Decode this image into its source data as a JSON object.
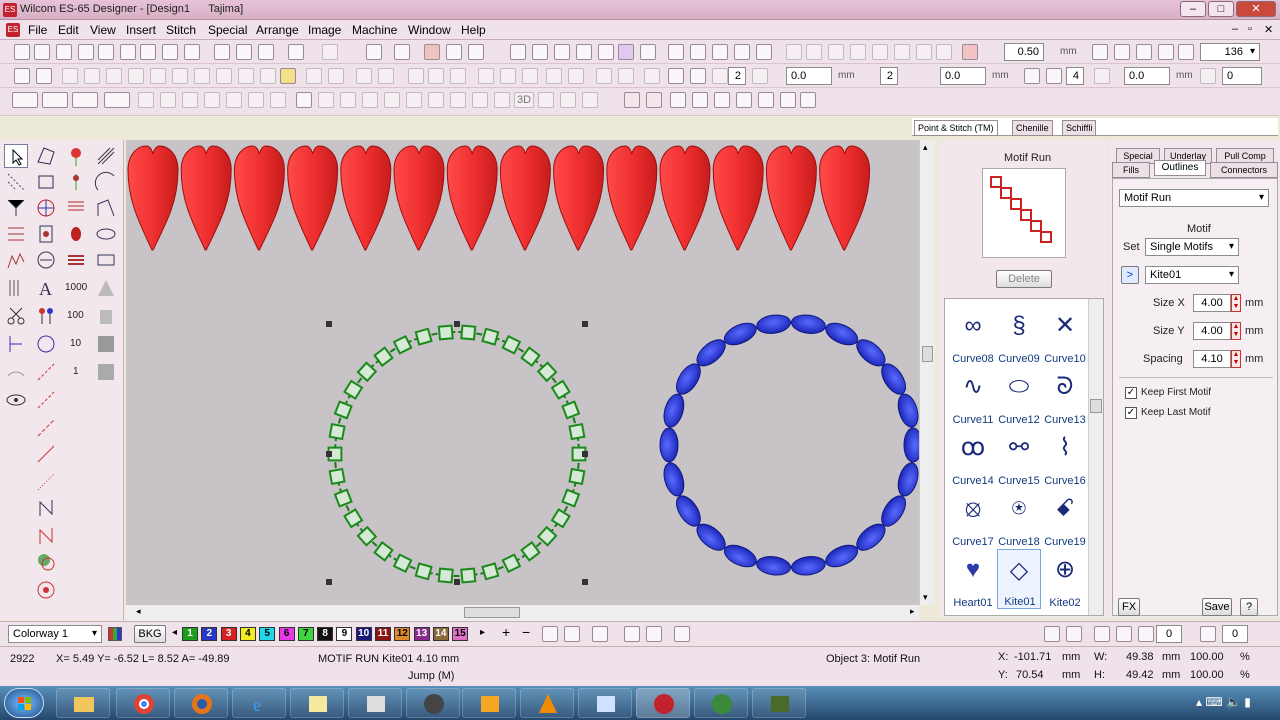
{
  "window": {
    "title": "Wilcom ES-65 Designer - [Design1",
    "title_machine": "Tajima]"
  },
  "menu": [
    "File",
    "Edit",
    "View",
    "Insert",
    "Stitch",
    "Special",
    "Arrange",
    "Image",
    "Machine",
    "Window",
    "Help"
  ],
  "toolbar": {
    "stitch_len": "0.50",
    "unit_mm": "mm",
    "zoom": "136",
    "field_a": "0.0",
    "field_b": "2",
    "field_c": "0.0",
    "field_d": "2",
    "field_e": "0.0",
    "field_f": "4",
    "field_g": "0.0",
    "field_h": "0"
  },
  "docker": {
    "top_tabs": [
      "Point & Stitch (TM)",
      "Chenille",
      "Schiffli"
    ],
    "motif_run_title": "Motif Run",
    "delete_label": "Delete",
    "motifs": [
      "Curve08",
      "Curve09",
      "Curve10",
      "Curve11",
      "Curve12",
      "Curve13",
      "Curve14",
      "Curve15",
      "Curve16",
      "Curve17",
      "Curve18",
      "Curve19",
      "Heart01",
      "Kite01",
      "Kite02"
    ],
    "selected_motif": "Kite01",
    "prop_tabs_row1": [
      "Special",
      "Underlay",
      "Pull Comp"
    ],
    "prop_tabs_row2": [
      "Fills",
      "Outlines",
      "Connectors"
    ],
    "outline_type": "Motif Run",
    "section": "Motif",
    "set_label": "Set",
    "set_value": "Single Motifs",
    "motif_btn": ">",
    "motif_value": "Kite01",
    "size_x_label": "Size X",
    "size_x": "4.00",
    "size_y_label": "Size Y",
    "size_y": "4.00",
    "spacing_label": "Spacing",
    "spacing": "4.10",
    "unit": "mm",
    "keep_first": "Keep First Motif",
    "keep_last": "Keep Last Motif",
    "fx": "FX",
    "save": "Save",
    "help": "?"
  },
  "colorbar": {
    "colorway": "Colorway 1",
    "bkg": "BKG",
    "swatches": [
      {
        "n": "1",
        "c": "#1e9e1e",
        "t": "#fff"
      },
      {
        "n": "2",
        "c": "#2b35c8",
        "t": "#fff"
      },
      {
        "n": "3",
        "c": "#d42222",
        "t": "#fff"
      },
      {
        "n": "4",
        "c": "#f2ea22",
        "t": "#000"
      },
      {
        "n": "5",
        "c": "#22d8e8",
        "t": "#000"
      },
      {
        "n": "6",
        "c": "#e838e8",
        "t": "#000"
      },
      {
        "n": "7",
        "c": "#3ed63e",
        "t": "#000"
      },
      {
        "n": "8",
        "c": "#111111",
        "t": "#fff"
      },
      {
        "n": "9",
        "c": "#ffffff",
        "t": "#000"
      },
      {
        "n": "10",
        "c": "#1a1a7a",
        "t": "#fff"
      },
      {
        "n": "11",
        "c": "#8a1414",
        "t": "#fff"
      },
      {
        "n": "12",
        "c": "#e08a2a",
        "t": "#000"
      },
      {
        "n": "13",
        "c": "#8a2a8a",
        "t": "#fff"
      },
      {
        "n": "14",
        "c": "#8a6a3a",
        "t": "#fff"
      },
      {
        "n": "15",
        "c": "#e070c8",
        "t": "#000"
      }
    ],
    "angle1": "0",
    "angle2": "0"
  },
  "status": {
    "stitch": "2922",
    "coords": "X=  5.49 Y=  -6.52 L=   8.52 A= -49.89",
    "motif": "MOTIF RUN Kite01  4.10 mm",
    "jump": "Jump (M)",
    "object": "Object 3: Motif Run",
    "x_label": "X:",
    "x": "-101.71",
    "y_label": "Y:",
    "y": "70.54",
    "w_label": "W:",
    "w": "49.38",
    "h_label": "H:",
    "h": "49.42",
    "pct_w": "100.00",
    "pct_h": "100.00",
    "mm": "mm",
    "pct": "%"
  },
  "taskbar": {
    "time": "",
    "apps": [
      "explorer",
      "chrome",
      "firefox",
      "ie",
      "notes",
      "media",
      "vlc",
      "paint",
      "wilcom",
      "world",
      "tool"
    ]
  }
}
